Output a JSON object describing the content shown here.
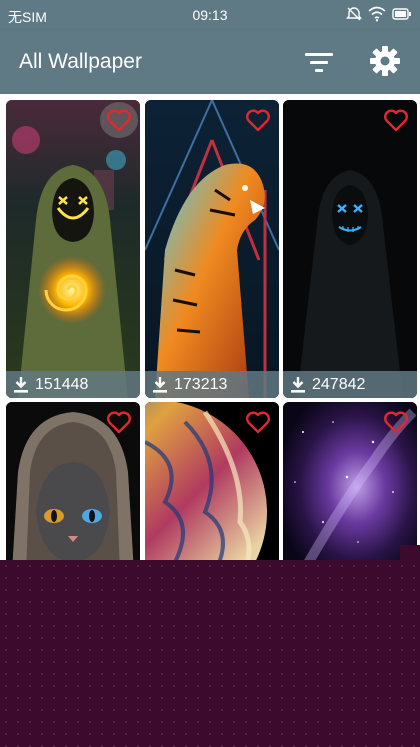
{
  "status_bar": {
    "carrier": "无SIM",
    "time": "09:13",
    "icons": [
      "alarm-off-icon",
      "wifi-icon",
      "battery-icon"
    ]
  },
  "app_bar": {
    "title": "All Wallpaper",
    "actions": [
      "filter-icon",
      "gear-icon"
    ],
    "background": "#5f7a84"
  },
  "wallpapers": [
    {
      "theme": "neon hooded figure with fire spiral",
      "downloads": "151448"
    },
    {
      "theme": "tiger with neon lights",
      "downloads": "173213"
    },
    {
      "theme": "hooded figure with neon mask",
      "downloads": "247842"
    },
    {
      "theme": "cat in hood",
      "downloads": ""
    },
    {
      "theme": "colorful planet",
      "downloads": ""
    },
    {
      "theme": "purple galaxy",
      "downloads": ""
    }
  ],
  "colors": {
    "heart": "#e0282e",
    "download_bar": "#60788280",
    "ad_background": "#3c0a2c"
  }
}
